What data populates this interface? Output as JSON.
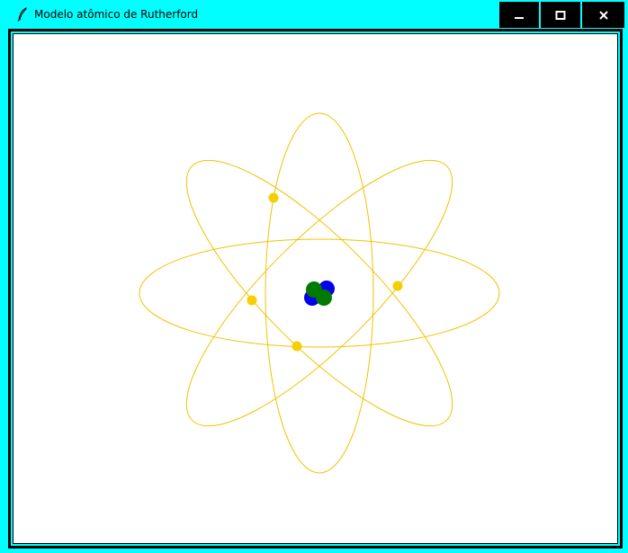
{
  "window": {
    "title": "Modelo atômico de Rutherford",
    "icon": "feather-icon",
    "controls": {
      "minimize_icon": "minimize-icon",
      "maximize_icon": "maximize-icon",
      "close_icon": "close-icon"
    }
  },
  "colors": {
    "titlebar": "#00ffff",
    "control_background": "#000000",
    "canvas_background": "#ffffff",
    "orbit": "#f2c200",
    "electron": "#f5cf00",
    "proton": "#0000ee",
    "neutron": "#007a00"
  },
  "atom": {
    "orbits": [
      {
        "name": "horizontal-orbit",
        "rotation_deg": 0
      },
      {
        "name": "vertical-orbit",
        "rotation_deg": 90
      },
      {
        "name": "diagonal-orbit-ascending",
        "rotation_deg": -45
      },
      {
        "name": "diagonal-orbit-descending",
        "rotation_deg": 45
      }
    ],
    "electrons": 4,
    "nucleus": {
      "protons": 2,
      "neutrons": 2
    }
  }
}
